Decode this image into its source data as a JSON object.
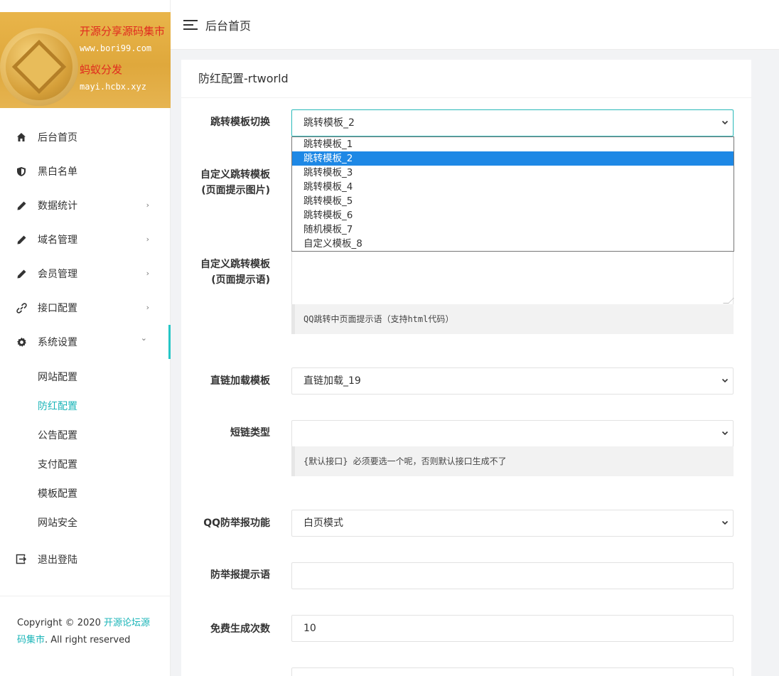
{
  "logo": {
    "line1": "开源分享源码集市",
    "line2": "www.bori99.com",
    "line3": "蚂蚁分发",
    "line4": "mayi.hcbx.xyz"
  },
  "sidebar": {
    "items": [
      {
        "label": "后台首页",
        "icon": "home-icon"
      },
      {
        "label": "黑白名单",
        "icon": "shield-icon"
      },
      {
        "label": "数据统计",
        "icon": "pencil-icon",
        "chevron": "›"
      },
      {
        "label": "域名管理",
        "icon": "pencil-icon",
        "chevron": "›"
      },
      {
        "label": "会员管理",
        "icon": "pencil-icon",
        "chevron": "›"
      },
      {
        "label": "接口配置",
        "icon": "link-icon",
        "chevron": "›"
      },
      {
        "label": "系统设置",
        "icon": "gear-icon",
        "chevron": "⌄"
      }
    ],
    "sub_items": [
      "网站配置",
      "防红配置",
      "公告配置",
      "支付配置",
      "模板配置",
      "网站安全"
    ],
    "active_sub": "防红配置",
    "logout": "退出登陆",
    "footer": {
      "prefix": "Copyright © 2020 ",
      "link": "开源论坛源码集市",
      "suffix": ". All right reserved"
    }
  },
  "header": {
    "title": "后台首页"
  },
  "card": {
    "title": "防红配置-rtworld"
  },
  "form": {
    "template_switch": {
      "label": "跳转模板切换",
      "value": "跳转模板_2"
    },
    "custom_image": {
      "label_line1": "自定义跳转模板",
      "label_line2": "(页面提示图片)"
    },
    "custom_text": {
      "label_line1": "自定义跳转模板",
      "label_line2": "(页面提示语)",
      "hint": "QQ跳转中页面提示语（支持html代码）"
    },
    "direct_template": {
      "label": "直链加载模板",
      "value": "直链加载_19"
    },
    "short_link": {
      "label": "短链类型",
      "value": "",
      "hint": "{默认接口} 必须要选一个呢，否则默认接口生成不了"
    },
    "anti_report": {
      "label": "QQ防举报功能",
      "value": "白页模式"
    },
    "report_tip": {
      "label": "防举报提示语",
      "value": ""
    },
    "free_count": {
      "label": "免费生成次数",
      "value": "10"
    }
  },
  "dropdown": {
    "options": [
      "跳转模板_1",
      "跳转模板_2",
      "跳转模板_3",
      "跳转模板_4",
      "跳转模板_5",
      "跳转模板_6",
      "随机模板_7",
      "自定义模板_8"
    ],
    "selected": "跳转模板_2"
  },
  "colors": {
    "accent": "#1bb5b8",
    "selection": "#1e88e5"
  }
}
